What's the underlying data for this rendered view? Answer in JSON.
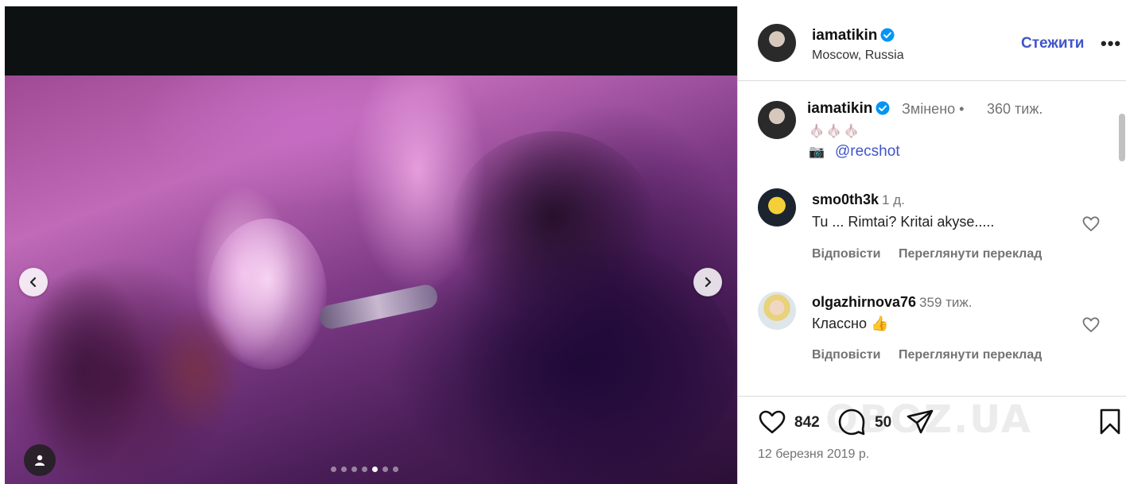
{
  "post": {
    "username": "iamatikin",
    "location": "Moscow, Russia",
    "follow_label": "Стежити",
    "more_label": "•••"
  },
  "caption": {
    "username": "iamatikin",
    "edited_label": "Змінено",
    "separator": "•",
    "time": "360 тиж.",
    "emoji_line": "🧄🧄🧄",
    "camera_emoji": "📷",
    "mention": "@recshot"
  },
  "comments": [
    {
      "username": "smo0th3k",
      "time": "1 д.",
      "text": "Tu ... Rimtai? Kritai akyse.....",
      "reply_label": "Відповісти",
      "translate_label": "Переглянути переклад"
    },
    {
      "username": "olgazhirnova76",
      "time": "359 тиж.",
      "text": "Классно 👍",
      "reply_label": "Відповісти",
      "translate_label": "Переглянути переклад"
    }
  ],
  "actions": {
    "like_count": "842",
    "comment_count": "50",
    "date": "12 березня 2019 р."
  },
  "carousel": {
    "total_slides": 7,
    "active_slide": 5
  },
  "watermark": "OBOZ.UA",
  "colors": {
    "link": "#3f55c8",
    "verified": "#0095f6",
    "muted": "#737373"
  }
}
